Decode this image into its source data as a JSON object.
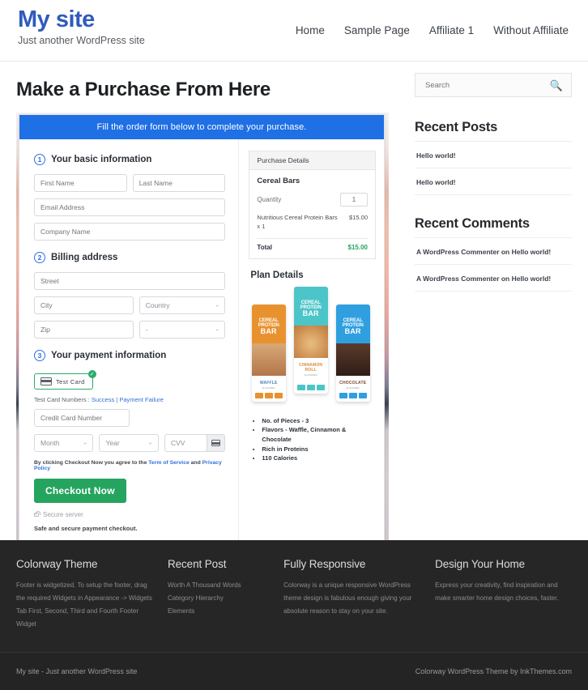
{
  "header": {
    "site_title": "My site",
    "tagline": "Just another WordPress site",
    "nav": [
      {
        "label": "Home"
      },
      {
        "label": "Sample Page"
      },
      {
        "label": "Affiliate 1"
      },
      {
        "label": "Without Affiliate"
      }
    ]
  },
  "page": {
    "title": "Make a Purchase From Here"
  },
  "form": {
    "banner": "Fill the order form below to complete your purchase.",
    "steps": {
      "basic": {
        "num": "1",
        "label": "Your basic information"
      },
      "billing": {
        "num": "2",
        "label": "Billing address"
      },
      "payment": {
        "num": "3",
        "label": "Your payment information"
      }
    },
    "fields": {
      "first_name": "First Name",
      "last_name": "Last Name",
      "email": "Email Address",
      "company": "Company Name",
      "street": "Street",
      "city": "City",
      "country": "Country",
      "zip": "Zip",
      "state": "-",
      "credit_card": "Credit Card Number",
      "month": "Month",
      "year": "Year",
      "cvv": "CVV"
    },
    "test_card": {
      "label": "Test Card",
      "check": "✓",
      "numbers_prefix": "Test Card Numbers : ",
      "success": "Success",
      "separator": " | ",
      "failure": "Payment Failure"
    },
    "agree": {
      "prefix": "By clicking Checkout Now you agree to the ",
      "terms": "Term of Service",
      "and": " and ",
      "privacy": "Privacy Policy"
    },
    "checkout_label": "Checkout Now",
    "secure_server": "Secure server",
    "safe_note": "Safe and secure payment checkout."
  },
  "purchase_details": {
    "heading": "Purchase Details",
    "product": "Cereal Bars",
    "quantity_label": "Quantity",
    "quantity_value": "1",
    "line_item": "Nutritious Cereal Protein Bars x 1",
    "line_amount": "$15.00",
    "total_label": "Total",
    "total_amount": "$15.00",
    "accent_color": "#25a45f"
  },
  "plan_details": {
    "heading": "Plan Details",
    "bars": [
      {
        "brand_top": "CEREAL",
        "brand_mid": "PROTEIN",
        "brand_big": "BAR",
        "flavor": "WAFFLE",
        "flavor_sub": "FLAVORED",
        "color": "#e8922f"
      },
      {
        "brand_top": "CEREAL",
        "brand_mid": "PROTEIN",
        "brand_big": "BAR",
        "flavor": "CINNAMON ROLL",
        "flavor_sub": "FLAVORED",
        "color": "#4cc5c8"
      },
      {
        "brand_top": "CEREAL",
        "brand_mid": "PROTEIN",
        "brand_big": "BAR",
        "flavor": "CHOCOLATE",
        "flavor_sub": "FLAVORED",
        "color": "#2f9fe0"
      }
    ],
    "features": [
      "No. of Pieces - 3",
      "Flavors - Waffle, Cinnamon & Chocolate",
      "Rich in Proteins",
      "110 Calories"
    ]
  },
  "sidebar": {
    "search": {
      "placeholder": "Search",
      "icon": "search-icon"
    },
    "recent_posts": {
      "title": "Recent Posts",
      "items": [
        "Hello world!",
        "Hello world!"
      ]
    },
    "recent_comments": {
      "title": "Recent Comments",
      "items": [
        "A WordPress Commenter on Hello world!",
        "A WordPress Commenter on Hello world!"
      ]
    }
  },
  "footer": {
    "columns": [
      {
        "title": "Colorway Theme",
        "text": "Footer is widgetized. To setup the footer, drag the required Widgets in Appearance -> Widgets Tab First, Second, Third and Fourth Footer Widget"
      },
      {
        "title": "Recent Post",
        "links": [
          "Worth A Thousand Words",
          "Category Hierarchy",
          "Elements"
        ]
      },
      {
        "title": "Fully Responsive",
        "text": "Colorway is a unique responsive WordPress theme design is fabulous enough giving your absolute reason to stay on your site."
      },
      {
        "title": "Design Your Home",
        "text": "Express your creativity, find inspiration and make smarter home design choices, faster."
      }
    ],
    "bottom_left": "My site - Just another WordPress site",
    "bottom_right": "Colorway WordPress Theme by InkThemes.com"
  }
}
